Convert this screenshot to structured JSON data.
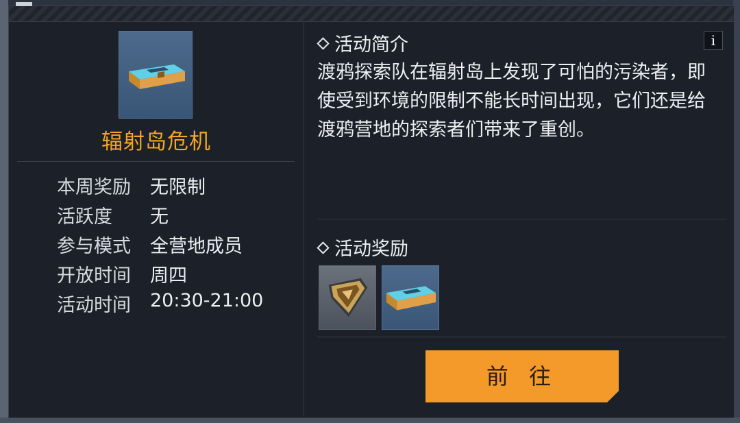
{
  "event": {
    "title": "辐射岛危机",
    "info": [
      {
        "label": "本周奖励",
        "value": "无限制"
      },
      {
        "label": "活跃度",
        "value": "无"
      },
      {
        "label": "参与模式",
        "value": "全营地成员"
      },
      {
        "label": "开放时间",
        "value": "周四"
      },
      {
        "label": "活动时间",
        "value": "20:30-21:00"
      }
    ]
  },
  "intro": {
    "heading": "活动简介",
    "text": "渡鸦探索队在辐射岛上发现了可怕的污染者，即使受到环境的限制不能长时间出现，它们还是给渡鸦营地的探索者们带来了重创。",
    "info_icon": "i"
  },
  "rewards": {
    "heading": "活动奖励",
    "items": [
      {
        "icon": "badge-icon"
      },
      {
        "icon": "supply-chest-icon"
      }
    ]
  },
  "action": {
    "go_label": "前 往"
  },
  "colors": {
    "accent": "#f5a623",
    "button": "#f39a2a",
    "panel": "#1b2029"
  }
}
